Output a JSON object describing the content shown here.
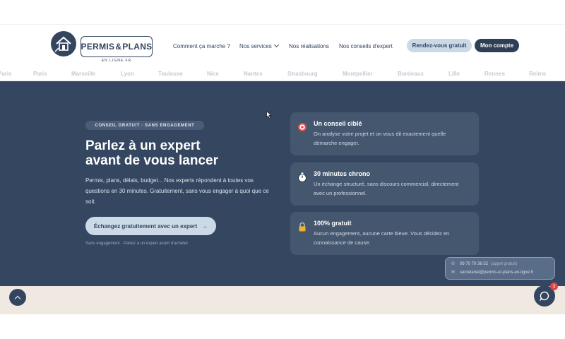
{
  "brand": {
    "name_part1": "PERMIS",
    "ampersand": "&",
    "name_part2": "PLANS",
    "subtitle": "EN LIGNE.FR"
  },
  "nav": {
    "how_it_works": "Comment ça marche ?",
    "services": "Nos services",
    "realisations": "Nos réalisations",
    "conseils": "Nos conseils d'expert",
    "rdv_button": "Rendez-vous gratuit",
    "account_button": "Mon compte"
  },
  "cities": [
    "Paris",
    "Paris",
    "Marseille",
    "Lyon",
    "Toulouse",
    "Nice",
    "Nantes",
    "Strasbourg",
    "Montpellier",
    "Bordeaux",
    "Lille",
    "Rennes",
    "Reims"
  ],
  "hero": {
    "tagline": "CONSEIL GRATUIT · SANS ENGAGEMENT",
    "headline_line1": "Parlez à un expert",
    "headline_line2": "avant de vous lancer",
    "intro": "Permis, plans, délais, budget... Nos experts répondent à toutes vos questions en 30 minutes. Gratuitement, sans vous engager à quoi que ce soit.",
    "cta_label": "Échangez gratuitement avec un expert",
    "cta_arrow": "→",
    "note": "Sans engagement · Parlez à un expert avant d'acheter"
  },
  "cards": [
    {
      "icon": "target-icon",
      "title": "Un conseil ciblé",
      "text": "On analyse votre projet et on vous dit exactement quelle démarche engager."
    },
    {
      "icon": "stopwatch-icon",
      "title": "30 minutes chrono",
      "text": "Un échange structuré, sans discours commercial, directement avec un professionnel."
    },
    {
      "icon": "padlock-icon",
      "title": "100% gratuit",
      "text": "Aucun engagement, aucune carte bleue. Vous décidez en connaissance de cause."
    }
  ],
  "contact": {
    "phone": "09 70 70 36 52",
    "phone_note": "(appel gratuit)",
    "email": "secretariat@permis-et-plans-en-ligne.fr"
  },
  "chat": {
    "badge_count": "1"
  },
  "colors": {
    "navy": "#344560",
    "hero_bg": "#344660",
    "card_bg": "#45576f",
    "light_blue": "#cbdae6",
    "beige": "#efe9e2",
    "badge_red": "#e0444a"
  }
}
